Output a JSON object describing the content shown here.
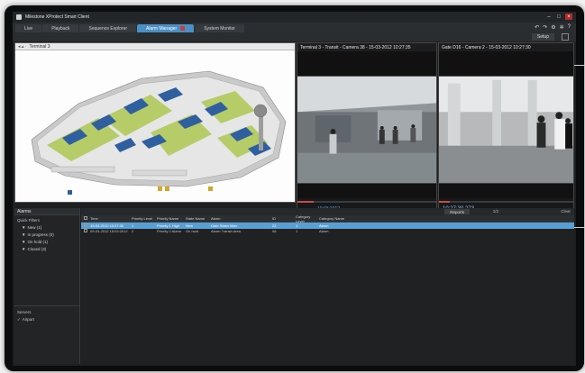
{
  "window": {
    "title": "Milestone XProtect Smart Client"
  },
  "tabs": [
    {
      "label": "Live"
    },
    {
      "label": "Playback"
    },
    {
      "label": "Sequence Explorer"
    },
    {
      "label": "Alarm Manager"
    },
    {
      "label": "System Monitor"
    }
  ],
  "subbar": {
    "setup_label": "Setup"
  },
  "map": {
    "title": "Terminal 3",
    "nav": "◂ ▴ ·"
  },
  "cameras": [
    {
      "title": "Terminal 3 - Transit - Camera 38 - 15-03-2012 10:27:35",
      "time": "10:03:2012",
      "progress": 0.12
    },
    {
      "title": "Gate D16 - Camera 2 - 15-03-2012 10:27:30",
      "time": "10:27:30.273",
      "progress": 0.08
    }
  ],
  "sidebar": {
    "header": "Alarms",
    "filters_label": "Quick Filters",
    "filters": [
      {
        "label": "New (1)"
      },
      {
        "label": "In progress (0)"
      },
      {
        "label": "On hold (1)"
      },
      {
        "label": "Closed (3)"
      }
    ],
    "servers_label": "Servers",
    "servers": [
      {
        "label": "Airport"
      }
    ]
  },
  "list": {
    "reports_label": "Reports",
    "page": "1/2",
    "clear_label": "Clear",
    "columns": [
      "Time",
      "Priority Level",
      "Priority Name",
      "State Name",
      "Alarm",
      "ID",
      "Category Level",
      "Category Name"
    ],
    "rows": [
      [
        "15-03-2012 10:27:30",
        "1",
        "Priority 1 High",
        "New",
        "Gate Stairs Man",
        "22",
        "1",
        "Alarm"
      ],
      [
        "09-03-2012 15:03:2012",
        "2",
        "Priority 2 Alarm",
        "On hold",
        "Alarm Transit Area",
        "08",
        "1",
        "Alarm"
      ]
    ]
  },
  "colors": {
    "accent": "#4b8fc4",
    "selected_row": "#5a9fd4",
    "timeline": "#c94b4b"
  }
}
